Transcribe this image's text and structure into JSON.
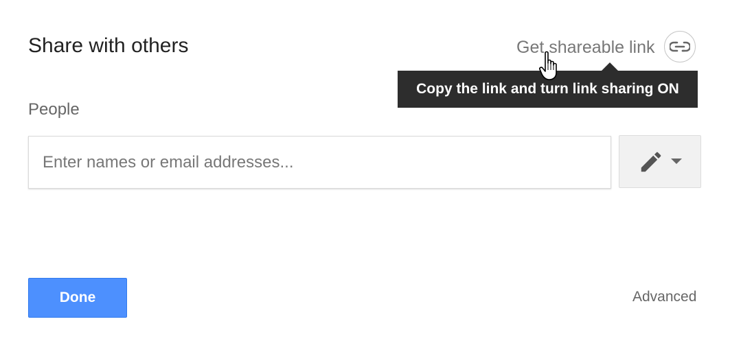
{
  "dialog": {
    "title": "Share with others",
    "share_link": {
      "label": "Get shareable link",
      "icon": "link-icon"
    },
    "tooltip": {
      "text": "Copy the link and turn link sharing ON"
    },
    "people": {
      "label": "People",
      "input_placeholder": "Enter names or email addresses...",
      "input_value": ""
    },
    "permission_button": {
      "icon": "pencil-icon",
      "dropdown_icon": "caret-down-icon"
    },
    "done_label": "Done",
    "advanced_label": "Advanced"
  },
  "colors": {
    "primary_button": "#4d90fe",
    "tooltip_bg": "#2d2d2d",
    "muted_text": "#777777"
  }
}
